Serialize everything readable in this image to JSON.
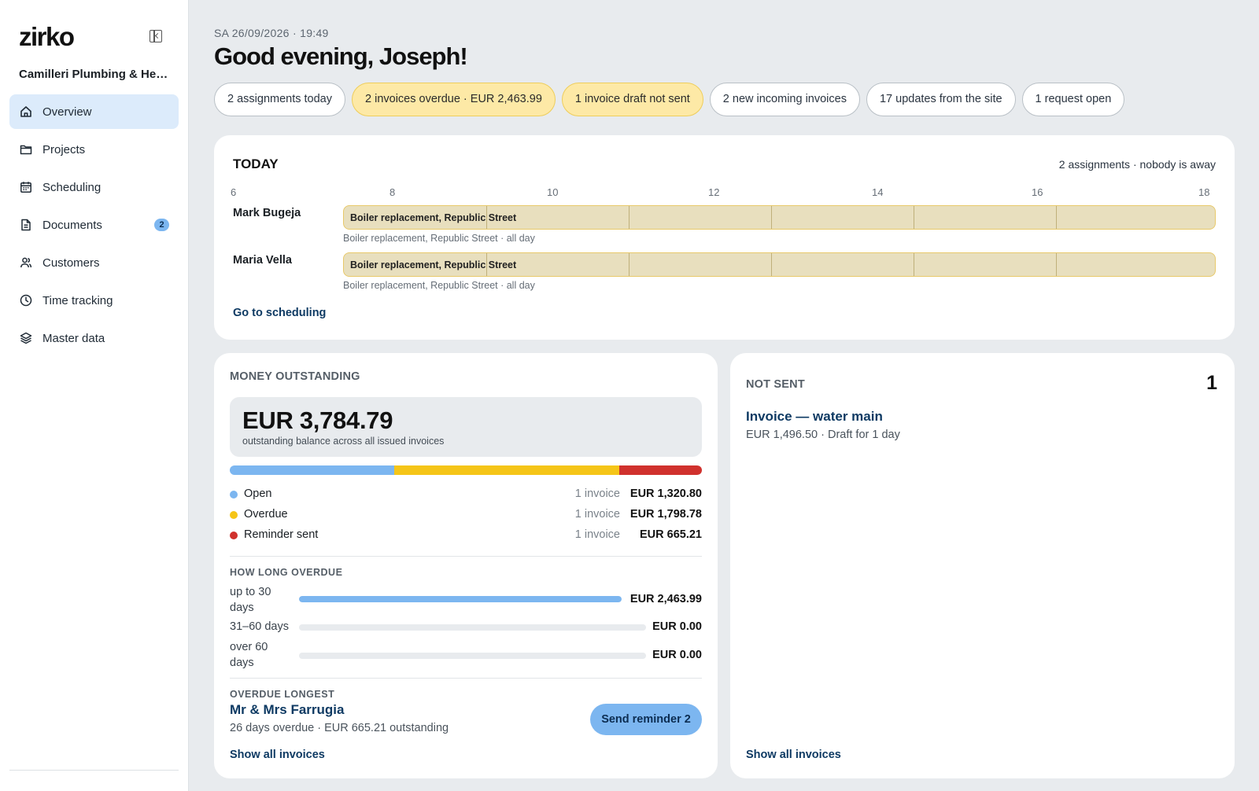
{
  "sidebar": {
    "logo": "zirko",
    "company": "Camilleri Plumbing & Heating",
    "items": [
      {
        "label": "Overview",
        "icon": "home-icon"
      },
      {
        "label": "Projects",
        "icon": "folder-icon"
      },
      {
        "label": "Scheduling",
        "icon": "calendar-icon"
      },
      {
        "label": "Documents",
        "icon": "document-icon",
        "badge": "2"
      },
      {
        "label": "Customers",
        "icon": "users-icon"
      },
      {
        "label": "Time tracking",
        "icon": "clock-icon"
      },
      {
        "label": "Master data",
        "icon": "layers-icon"
      }
    ]
  },
  "header": {
    "datetime": "SA 26/09/2026 · 19:49",
    "greeting": "Good evening, Joseph!"
  },
  "chips": [
    "2 assignments today",
    "2 invoices overdue · EUR 2,463.99",
    "1 invoice draft not sent",
    "2 new incoming invoices",
    "17 updates from the site",
    "1 request open"
  ],
  "today": {
    "title": "TODAY",
    "summary": "2 assignments · nobody is away",
    "hours": [
      "6",
      "8",
      "10",
      "12",
      "14",
      "16",
      "18"
    ],
    "rows": [
      {
        "person": "Mark Bugeja",
        "bar_label": "Boiler replacement, Republic Street",
        "sub": "Boiler replacement, Republic Street · all day"
      },
      {
        "person": "Maria Vella",
        "bar_label": "Boiler replacement, Republic Street",
        "sub": "Boiler replacement, Republic Street · all day"
      }
    ],
    "link": "Go to scheduling"
  },
  "money": {
    "title": "MONEY OUTSTANDING",
    "total": "EUR 3,784.79",
    "total_sub": "outstanding balance across all issued invoices",
    "colors": {
      "open": "#7cb6f0",
      "overdue": "#f5c518",
      "reminder": "#d0312d"
    },
    "breakdown": [
      {
        "name": "Open",
        "count": "1 invoice",
        "amount": "EUR 1,320.80",
        "value": 1320.8
      },
      {
        "name": "Overdue",
        "count": "1 invoice",
        "amount": "EUR 1,798.78",
        "value": 1798.78
      },
      {
        "name": "Reminder sent",
        "count": "1 invoice",
        "amount": "EUR 665.21",
        "value": 665.21
      }
    ],
    "aging_title": "HOW LONG OVERDUE",
    "aging": [
      {
        "label": "up to 30 days",
        "amount": "EUR 2,463.99",
        "fraction": 1.0
      },
      {
        "label": "31–60 days",
        "amount": "EUR 0.00",
        "fraction": 0.0
      },
      {
        "label": "over 60 days",
        "amount": "EUR 0.00",
        "fraction": 0.0
      }
    ],
    "longest_title": "OVERDUE LONGEST",
    "longest_customer": "Mr & Mrs Farrugia",
    "longest_sub": "26 days overdue · EUR 665.21 outstanding",
    "reminder_button": "Send reminder 2",
    "show_all": "Show all invoices"
  },
  "notsent": {
    "title": "NOT SENT",
    "count": "1",
    "invoice_title": "Invoice — water main",
    "invoice_sub": "EUR 1,496.50 · Draft for 1 day",
    "show_all": "Show all invoices"
  }
}
